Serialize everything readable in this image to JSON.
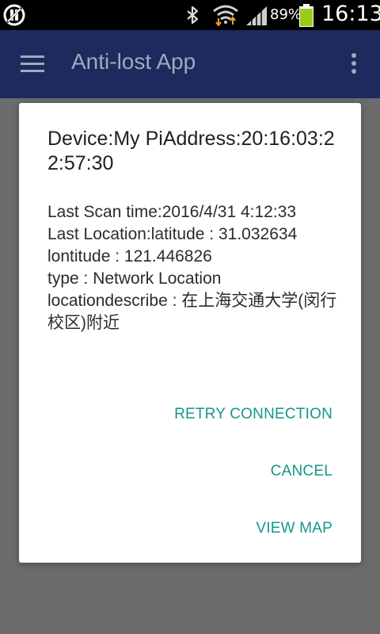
{
  "status_bar": {
    "battery_percent": "89%",
    "time": "16:13",
    "icons": [
      "notification-icon",
      "bluetooth-icon",
      "wifi-icon",
      "signal-icon",
      "battery-icon"
    ]
  },
  "app_bar": {
    "title": "Anti-lost App",
    "menu_icon": "hamburger-menu-icon",
    "overflow_icon": "more-vert-icon"
  },
  "dialog": {
    "title": "Device:My PiAddress:20:16:03:22:57:30",
    "body_lines": [
      "Last Scan time:2016/4/31 4:12:33",
      "Last Location:latitude : 31.032634",
      "lontitude : 121.446826",
      "type : Network Location",
      "locationdescribe : 在上海交通大学(闵行校区)附近"
    ],
    "buttons": {
      "retry": "RETRY CONNECTION",
      "cancel": "CANCEL",
      "view_map": "VIEW MAP"
    }
  },
  "colors": {
    "accent": "#14978a",
    "app_bar": "#1e2a5d",
    "scrim": "#6b6b6b",
    "battery": "#9ccb1c"
  }
}
